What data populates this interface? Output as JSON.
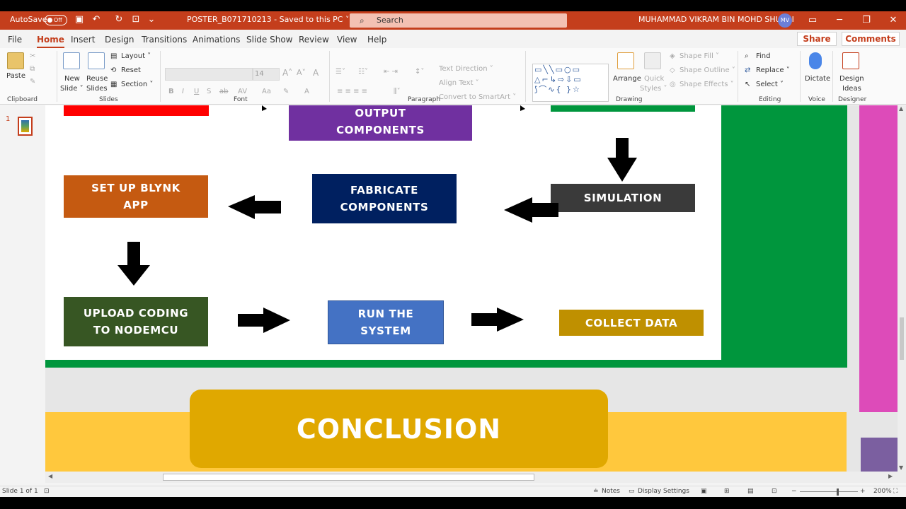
{
  "titlebar": {
    "autosave_label": "AutoSave",
    "autosave_state": "Off",
    "doc_title": "POSTER_B071710213  -  Saved to this PC  ˅",
    "search_placeholder": "Search",
    "user_name": "MUHAMMAD VIKRAM BIN MOHD SHUKRI",
    "user_initials": "MV"
  },
  "tabs": [
    "File",
    "Home",
    "Insert",
    "Design",
    "Transitions",
    "Animations",
    "Slide Show",
    "Review",
    "View",
    "Help"
  ],
  "share_label": "Share",
  "comments_label": "Comments",
  "ribbon": {
    "clipboard": {
      "paste": "Paste",
      "label": "Clipboard"
    },
    "slides": {
      "new_slide": "New",
      "new_slide2": "Slide ˅",
      "reuse": "Reuse",
      "reuse2": "Slides",
      "layout": "Layout ˅",
      "reset": "Reset",
      "section": "Section ˅",
      "label": "Slides"
    },
    "font": {
      "size": "14",
      "label": "Font",
      "b": "B",
      "i": "I",
      "u": "U",
      "s": "S",
      "ab": "ab",
      "av": "AV"
    },
    "paragraph": {
      "text_direction": "Text Direction ˅",
      "align_text": "Align Text ˅",
      "smartart": "Convert to SmartArt ˅",
      "label": "Paragraph"
    },
    "drawing": {
      "arrange": "Arrange",
      "quick": "Quick",
      "styles": "Styles ˅",
      "shape_fill": "Shape Fill ˅",
      "shape_outline": "Shape Outline ˅",
      "shape_effects": "Shape Effects ˅",
      "label": "Drawing"
    },
    "editing": {
      "find": "Find",
      "replace": "Replace ˅",
      "select": "Select ˅",
      "label": "Editing"
    },
    "voice": {
      "dictate": "Dictate",
      "label": "Voice"
    },
    "designer": {
      "design": "Design",
      "ideas": "Ideas",
      "label": "Designer"
    }
  },
  "slide_number": "1",
  "flow": {
    "output": "OUTPUT\nCOMPONENTS",
    "blynk": "SET UP BLYNK\nAPP",
    "fabricate": "FABRICATE\nCOMPONENTS",
    "simulation": "SIMULATION",
    "upload": "UPLOAD CODING\nTO NODEMCU",
    "run": "RUN THE\nSYSTEM",
    "collect": "COLLECT DATA"
  },
  "conclusion": "CONCLUSION",
  "status": {
    "slide": "Slide 1 of 1",
    "notes": "Notes",
    "display": "Display Settings",
    "zoom": "200%"
  },
  "colors": {
    "accent": "#c43e1c",
    "purple": "#7030a0",
    "orange": "#c55a11",
    "navy": "#002060",
    "dark": "#3a3a3a",
    "olive": "#375623",
    "blue": "#4472c4",
    "gold": "#bf9000",
    "green": "#00963d",
    "yellow": "#ffc83d",
    "amber": "#e0a800",
    "pink": "#dd4bb9"
  }
}
